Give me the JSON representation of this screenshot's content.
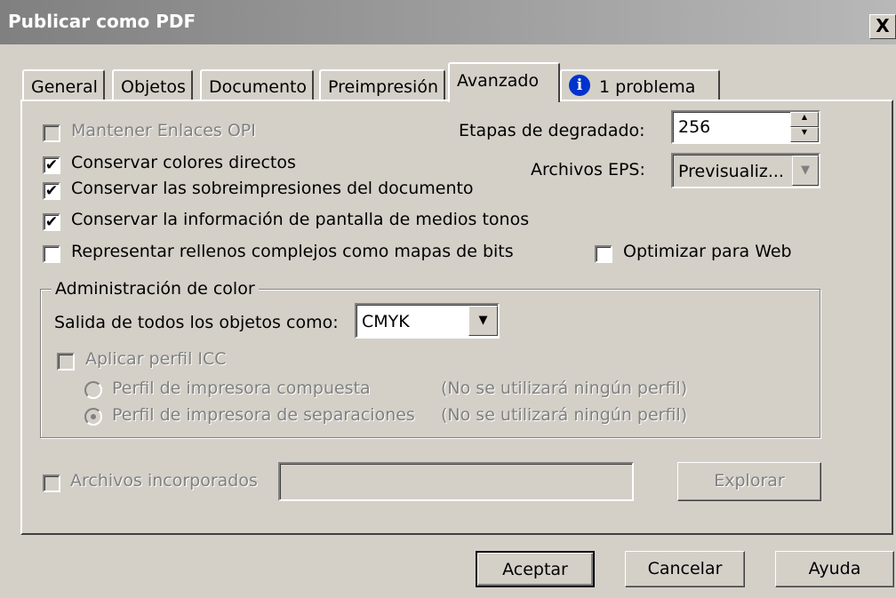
{
  "window": {
    "title": "Publicar como PDF",
    "close_label": "X"
  },
  "tabs": [
    {
      "label": "General"
    },
    {
      "label": "Objetos"
    },
    {
      "label": "Documento"
    },
    {
      "label": "Preimpresión"
    },
    {
      "label": "Avanzado"
    },
    {
      "label": "1 problema"
    }
  ],
  "options": {
    "opi": {
      "label": "Mantener Enlaces OPI",
      "checked": false,
      "enabled": false
    },
    "spot": {
      "label": "Conservar colores directos",
      "checked": true
    },
    "overprint": {
      "label": "Conservar las sobreimpresiones del documento",
      "checked": true
    },
    "halftone": {
      "label": "Conservar la información de pantalla de medios tonos",
      "checked": true
    },
    "complex_fills": {
      "label": "Representar rellenos complejos como mapas de bits",
      "checked": false
    },
    "web": {
      "label": "Optimizar para Web",
      "checked": false
    }
  },
  "gradient": {
    "label": "Etapas de degradado:",
    "value": "256"
  },
  "eps": {
    "label": "Archivos EPS:",
    "value": "Previsualiz..."
  },
  "color": {
    "group_label": "Administración de color",
    "output_label": "Salida de todos los objetos como:",
    "output_value": "CMYK",
    "icc_label": "Aplicar perfil ICC",
    "composite_label": "Perfil de impresora compuesta",
    "composite_note": "(No se utilizará ningún perfil)",
    "separations_label": "Perfil de impresora de separaciones",
    "separations_note": "(No se utilizará ningún perfil)"
  },
  "embedded": {
    "label": "Archivos incorporados",
    "value": "",
    "browse_label": "Explorar"
  },
  "buttons": {
    "ok": "Aceptar",
    "cancel": "Cancelar",
    "help": "Ayuda"
  },
  "colors": {
    "info_icon": "#0033cc",
    "disabled_text": "#808080"
  }
}
